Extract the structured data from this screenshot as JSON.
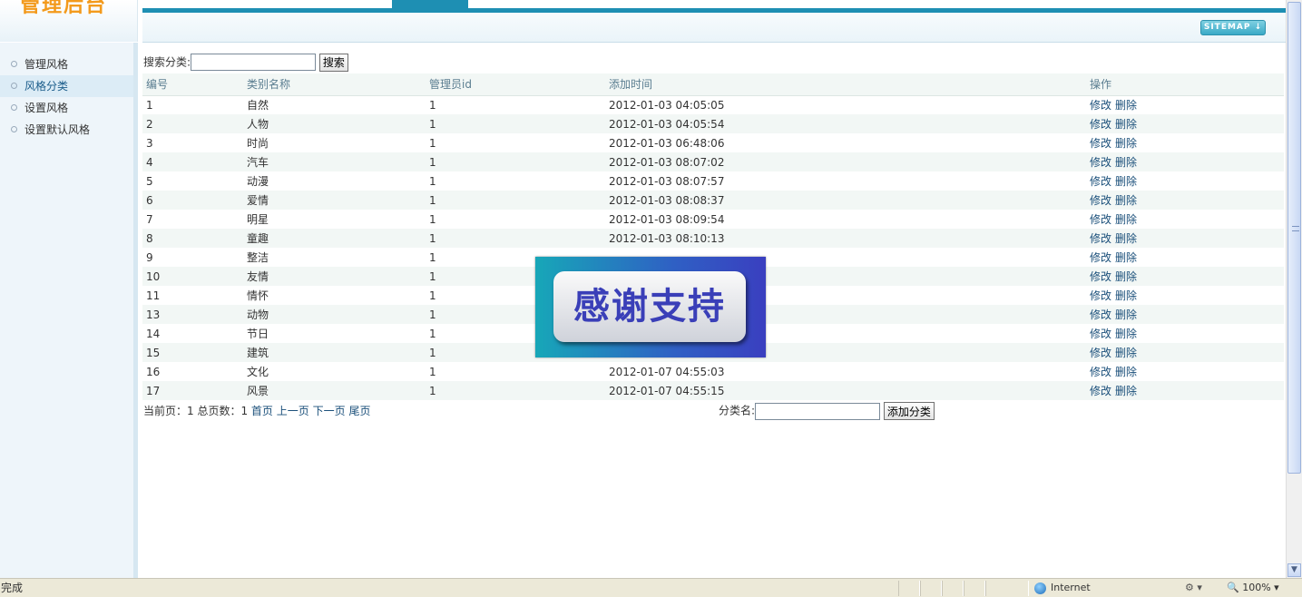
{
  "header": {
    "logo_text": "管理后台",
    "sitemap_label": "SITEMAP ↓"
  },
  "sidebar": {
    "items": [
      {
        "label": "管理风格"
      },
      {
        "label": "风格分类"
      },
      {
        "label": "设置风格"
      },
      {
        "label": "设置默认风格"
      }
    ]
  },
  "search": {
    "label": "搜索分类:",
    "value": "",
    "button": "搜索"
  },
  "table": {
    "headers": [
      "编号",
      "类别名称",
      "管理员id",
      "添加时间",
      "操作"
    ],
    "edit_label": "修改",
    "delete_label": "删除",
    "rows": [
      {
        "id": "1",
        "name": "自然",
        "admin": "1",
        "time": "2012-01-03 04:05:05"
      },
      {
        "id": "2",
        "name": "人物",
        "admin": "1",
        "time": "2012-01-03 04:05:54"
      },
      {
        "id": "3",
        "name": "时尚",
        "admin": "1",
        "time": "2012-01-03 06:48:06"
      },
      {
        "id": "4",
        "name": "汽车",
        "admin": "1",
        "time": "2012-01-03 08:07:02"
      },
      {
        "id": "5",
        "name": "动漫",
        "admin": "1",
        "time": "2012-01-03 08:07:57"
      },
      {
        "id": "6",
        "name": "爱情",
        "admin": "1",
        "time": "2012-01-03 08:08:37"
      },
      {
        "id": "7",
        "name": "明星",
        "admin": "1",
        "time": "2012-01-03 08:09:54"
      },
      {
        "id": "8",
        "name": "童趣",
        "admin": "1",
        "time": "2012-01-03 08:10:13"
      },
      {
        "id": "9",
        "name": "整洁",
        "admin": "1",
        "time": ""
      },
      {
        "id": "10",
        "name": "友情",
        "admin": "1",
        "time": ""
      },
      {
        "id": "11",
        "name": "情怀",
        "admin": "1",
        "time": ""
      },
      {
        "id": "13",
        "name": "动物",
        "admin": "1",
        "time": ""
      },
      {
        "id": "14",
        "name": "节日",
        "admin": "1",
        "time": ""
      },
      {
        "id": "15",
        "name": "建筑",
        "admin": "1",
        "time": ""
      },
      {
        "id": "16",
        "name": "文化",
        "admin": "1",
        "time": "2012-01-07 04:55:03"
      },
      {
        "id": "17",
        "name": "风景",
        "admin": "1",
        "time": "2012-01-07 04:55:15"
      }
    ]
  },
  "pager": {
    "info": "当前页：1 总页数：1",
    "first": "首页",
    "prev": "上一页",
    "next": "下一页",
    "last": "尾页"
  },
  "add": {
    "label": "分类名:",
    "value": "",
    "button": "添加分类"
  },
  "banner": {
    "text": "感谢支持"
  },
  "statusbar": {
    "status": "完成",
    "zone": "Internet",
    "zoom": "100%"
  }
}
